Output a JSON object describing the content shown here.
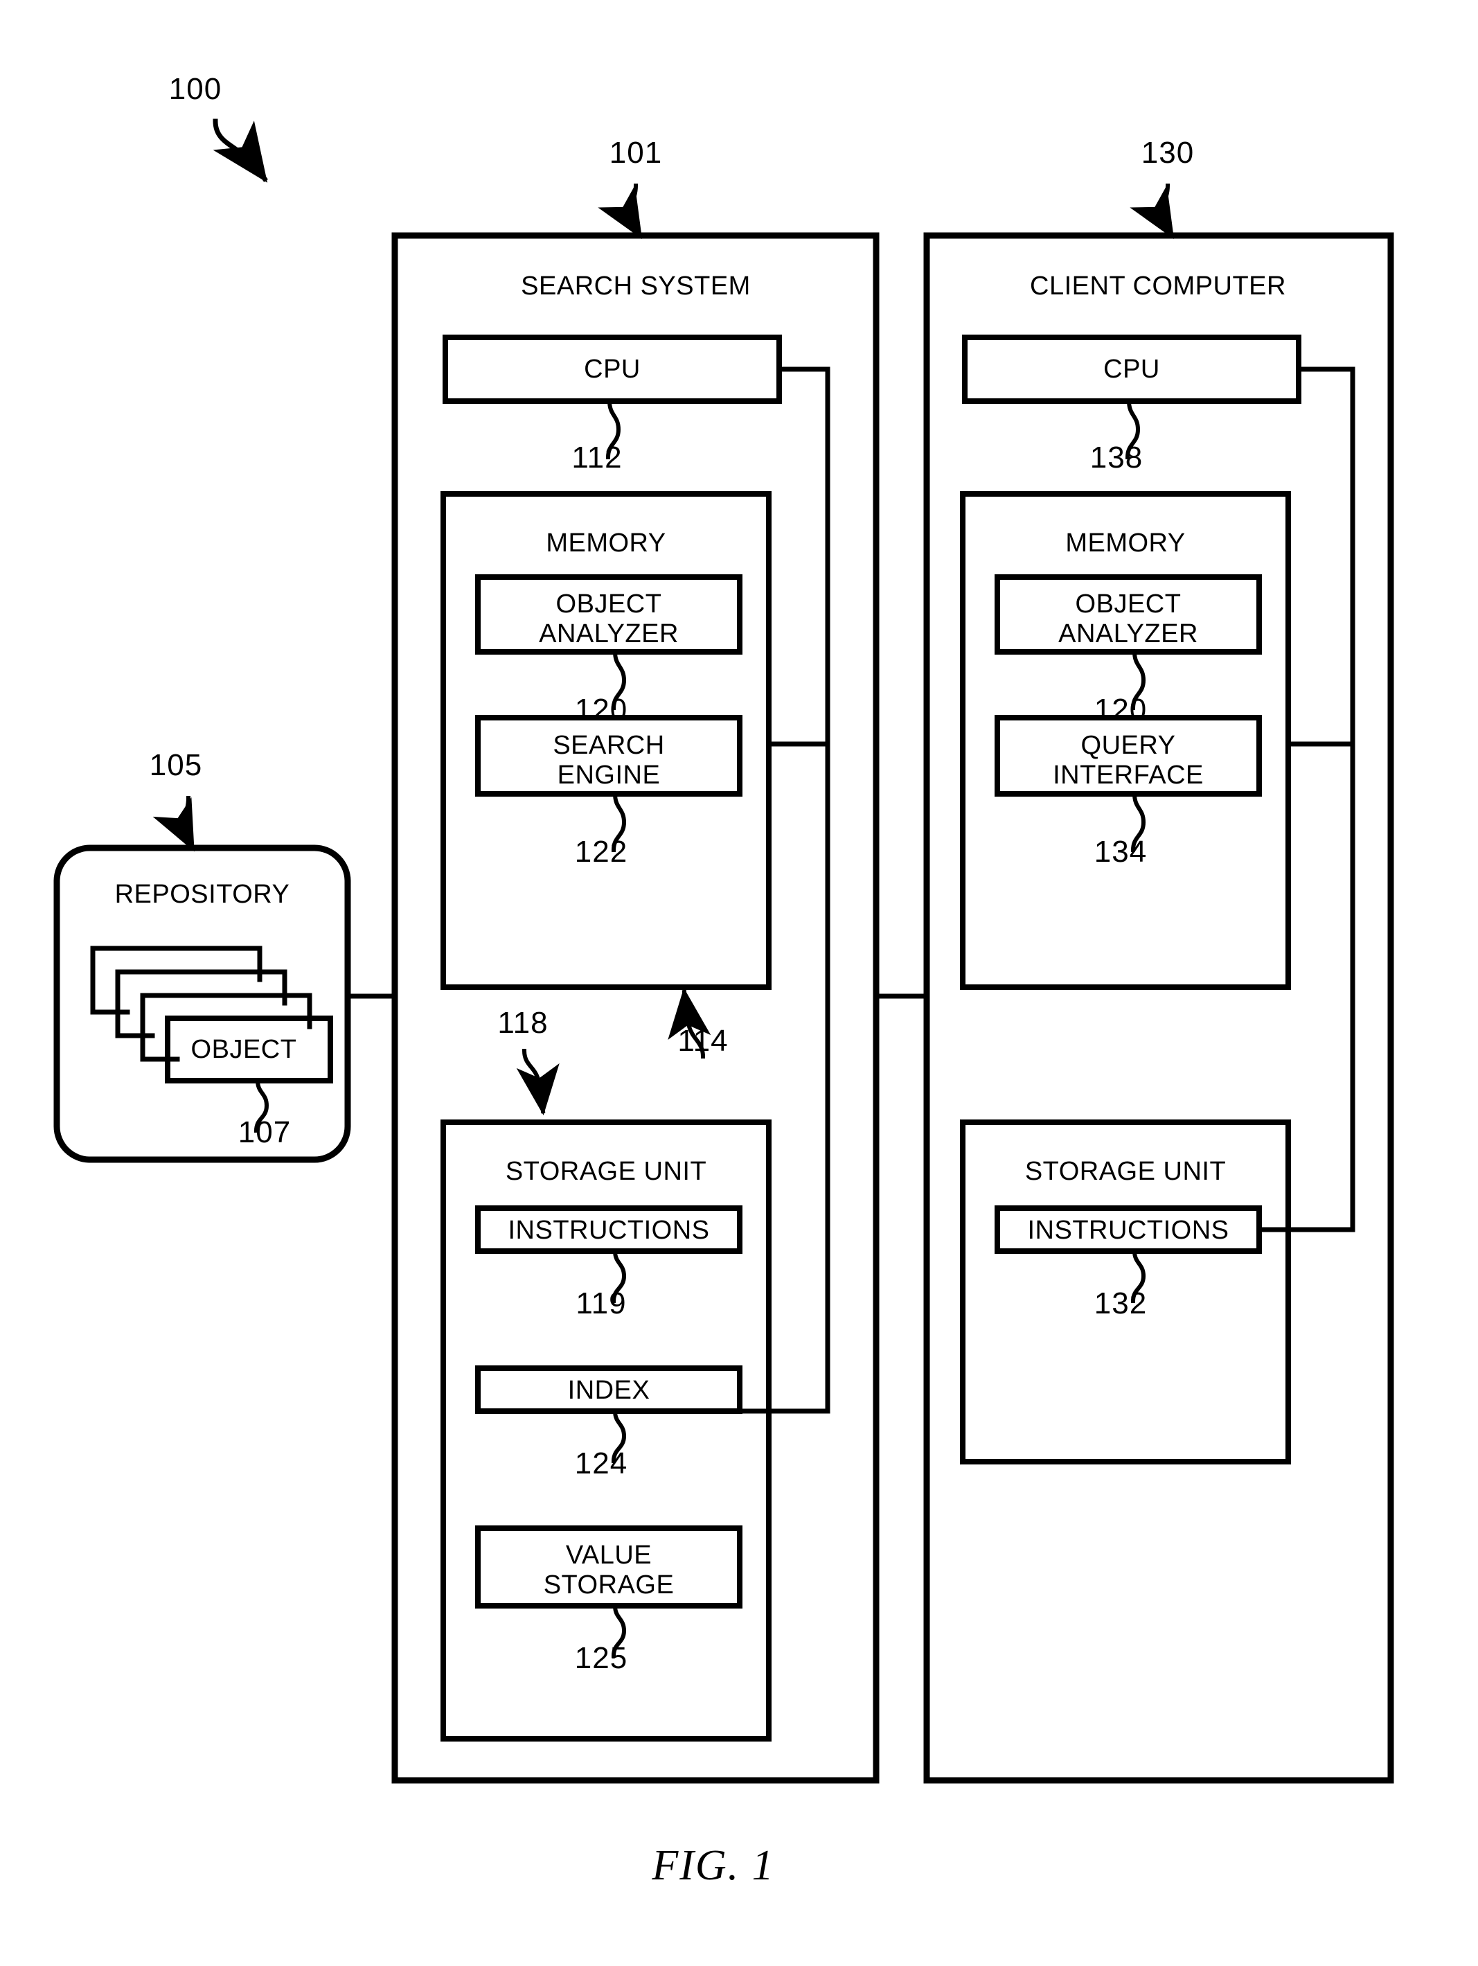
{
  "figure": {
    "caption": "FIG. 1",
    "system_ref": "100"
  },
  "repository": {
    "ref": "105",
    "title": "REPOSITORY",
    "object": {
      "label": "OBJECT",
      "ref": "107"
    },
    "stack_count": 4
  },
  "search_system": {
    "ref": "101",
    "title": "SEARCH SYSTEM",
    "cpu": {
      "label": "CPU",
      "ref": "112"
    },
    "memory": {
      "ref": "114",
      "title": "MEMORY",
      "modules": [
        {
          "label": "OBJECT\nANALYZER",
          "ref": "120"
        },
        {
          "label": "SEARCH\nENGINE",
          "ref": "122"
        }
      ]
    },
    "storage_unit": {
      "ref": "118",
      "title": "STORAGE UNIT",
      "modules": [
        {
          "label": "INSTRUCTIONS",
          "ref": "119"
        },
        {
          "label": "INDEX",
          "ref": "124"
        },
        {
          "label": "VALUE\nSTORAGE",
          "ref": "125"
        }
      ]
    }
  },
  "client_computer": {
    "ref": "130",
    "title": "CLIENT COMPUTER",
    "cpu": {
      "label": "CPU",
      "ref": "138"
    },
    "memory": {
      "title": "MEMORY",
      "modules": [
        {
          "label": "OBJECT\nANALYZER",
          "ref": "120"
        },
        {
          "label": "QUERY\nINTERFACE",
          "ref": "134"
        }
      ]
    },
    "storage_unit": {
      "title": "STORAGE UNIT",
      "modules": [
        {
          "label": "INSTRUCTIONS",
          "ref": "132"
        }
      ]
    }
  },
  "style": {
    "ink": "#000000",
    "paper": "#ffffff"
  }
}
